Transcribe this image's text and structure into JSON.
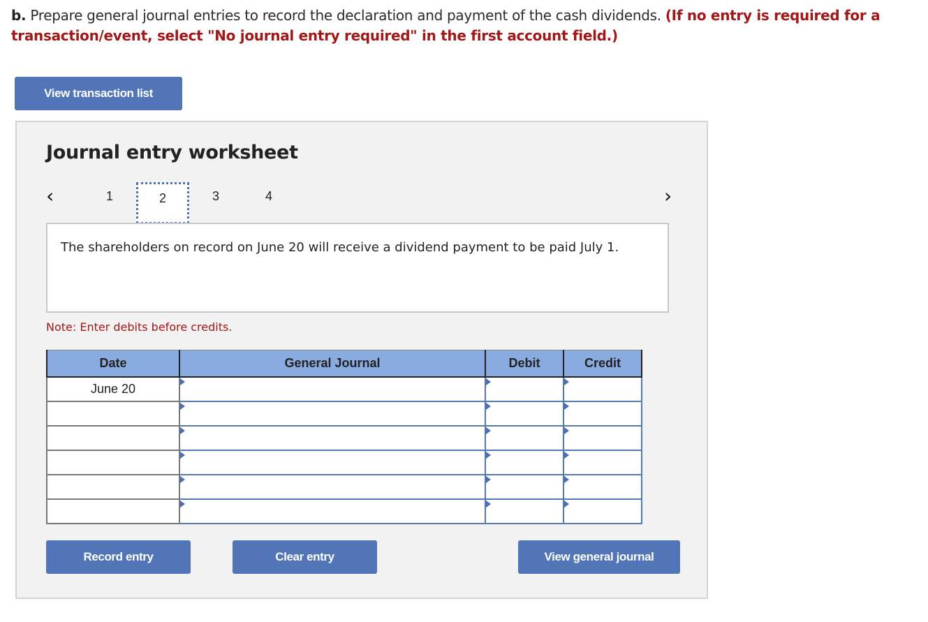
{
  "instructions": {
    "lead": "b.",
    "text": " Prepare general journal entries to record the declaration and payment of the cash dividends. ",
    "emphasis": "(If no entry is required for a transaction/event, select \"No journal entry required\" in the first account field.)"
  },
  "buttons": {
    "view_transaction_list": "View transaction list",
    "record_entry": "Record entry",
    "clear_entry": "Clear entry",
    "view_general_journal": "View general journal"
  },
  "worksheet": {
    "title": "Journal entry worksheet",
    "prev_icon": "chevron-left-icon",
    "next_icon": "chevron-right-icon",
    "pages": [
      "1",
      "2",
      "3",
      "4"
    ],
    "active_page": "2",
    "description": "The shareholders on record on June 20 will receive a dividend payment to be paid July 1.",
    "note": "Note: Enter debits before credits."
  },
  "journal": {
    "headers": [
      "Date",
      "General Journal",
      "Debit",
      "Credit"
    ],
    "rows": [
      {
        "date": "June 20",
        "account": "",
        "debit": "",
        "credit": ""
      },
      {
        "date": "",
        "account": "",
        "debit": "",
        "credit": ""
      },
      {
        "date": "",
        "account": "",
        "debit": "",
        "credit": ""
      },
      {
        "date": "",
        "account": "",
        "debit": "",
        "credit": ""
      },
      {
        "date": "",
        "account": "",
        "debit": "",
        "credit": ""
      },
      {
        "date": "",
        "account": "",
        "debit": "",
        "credit": ""
      }
    ]
  },
  "colors": {
    "button": "#5175b6",
    "header": "#8aabdf",
    "emphasis": "#a01818"
  }
}
